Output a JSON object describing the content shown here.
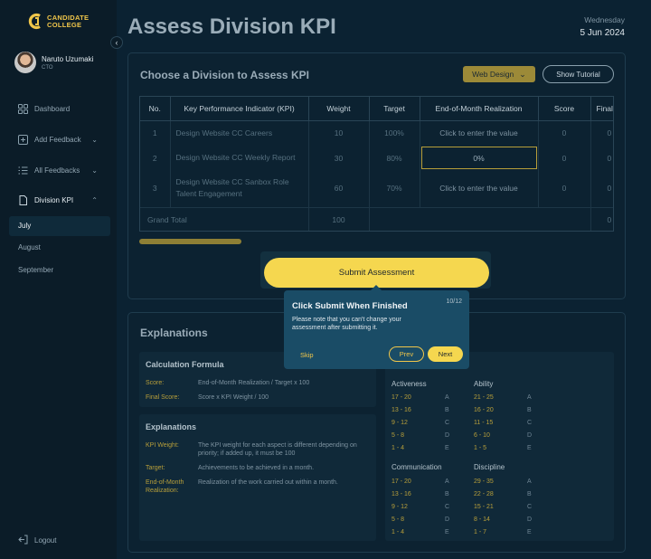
{
  "brand": {
    "line1": "CANDIDATE",
    "line2": "COLLEGE"
  },
  "user": {
    "name": "Naruto Uzumaki",
    "role": "CTO"
  },
  "sidebar": {
    "items": [
      {
        "label": "Dashboard",
        "icon": "grid-icon"
      },
      {
        "label": "Add Feedback",
        "icon": "plus-square-icon"
      },
      {
        "label": "All Feedbacks",
        "icon": "list-icon"
      },
      {
        "label": "Division KPI",
        "icon": "document-icon"
      }
    ],
    "sub_items": [
      "July",
      "August",
      "September"
    ],
    "logout": "Logout"
  },
  "header": {
    "title": "Assess Division KPI",
    "day": "Wednesday",
    "date": "5 Jun 2024"
  },
  "assess": {
    "title": "Choose a Division to Assess KPI",
    "division": "Web Design",
    "tutorial": "Show Tutorial",
    "columns": [
      "No.",
      "Key Performance Indicator (KPI)",
      "Weight",
      "Target",
      "End-of-Month Realization",
      "Score",
      "Final Score"
    ],
    "rows": [
      {
        "no": "1",
        "kpi": "Design Website CC Careers",
        "weight": "10",
        "target": "100%",
        "realization": "Click to enter the value",
        "score": "0",
        "final": "0"
      },
      {
        "no": "2",
        "kpi": "Design Website CC Weekly Report",
        "weight": "30",
        "target": "80%",
        "realization": "0%",
        "score": "0",
        "final": "0"
      },
      {
        "no": "3",
        "kpi": "Design Website CC Sanbox Role Talent Engagement",
        "weight": "60",
        "target": "70%",
        "realization": "Click to enter the value",
        "score": "0",
        "final": "0"
      }
    ],
    "grand_total": {
      "label": "Grand Total",
      "weight": "100",
      "final": "0"
    },
    "submit": "Submit Assessment"
  },
  "tooltip": {
    "title": "Click Submit When Finished",
    "step": "10/12",
    "body": "Please note that you can't change your assessment after submitting it.",
    "skip": "Skip",
    "prev": "Prev",
    "next": "Next"
  },
  "explanations": {
    "title": "Explanations",
    "formula": {
      "title": "Calculation Formula",
      "items": [
        {
          "k": "Score:",
          "v": "End-of-Month Realization / Target x 100"
        },
        {
          "k": "Final Score:",
          "v": "Score x KPI Weight / 100"
        }
      ]
    },
    "defs": {
      "title": "Explanations",
      "items": [
        {
          "k": "KPI Weight:",
          "v": "The KPI weight for each aspect is different depending on priority; if added up, it must be 100"
        },
        {
          "k": "Target:",
          "v": "Achievements to be achieved in a month."
        },
        {
          "k": "End-of-Month Realization:",
          "v": "Realization of the work carried out within a month."
        }
      ]
    },
    "grades": [
      {
        "title": "Activeness",
        "rows": [
          [
            "17 - 20",
            "A"
          ],
          [
            "13 - 16",
            "B"
          ],
          [
            "9 - 12",
            "C"
          ],
          [
            "5 - 8",
            "D"
          ],
          [
            "1 - 4",
            "E"
          ]
        ]
      },
      {
        "title": "Ability",
        "rows": [
          [
            "21 - 25",
            "A"
          ],
          [
            "16 - 20",
            "B"
          ],
          [
            "11 - 15",
            "C"
          ],
          [
            "6 - 10",
            "D"
          ],
          [
            "1 - 5",
            "E"
          ]
        ]
      },
      {
        "title": "Communication",
        "rows": [
          [
            "17 - 20",
            "A"
          ],
          [
            "13 - 16",
            "B"
          ],
          [
            "9 - 12",
            "C"
          ],
          [
            "5 - 8",
            "D"
          ],
          [
            "1 - 4",
            "E"
          ]
        ]
      },
      {
        "title": "Discipline",
        "rows": [
          [
            "29 - 35",
            "A"
          ],
          [
            "22 - 28",
            "B"
          ],
          [
            "15 - 21",
            "C"
          ],
          [
            "8 - 14",
            "D"
          ],
          [
            "1 - 7",
            "E"
          ]
        ]
      }
    ]
  },
  "colors": {
    "accent": "#f5d74f",
    "background": "#0b2232",
    "sidebar": "#0b1c28"
  }
}
